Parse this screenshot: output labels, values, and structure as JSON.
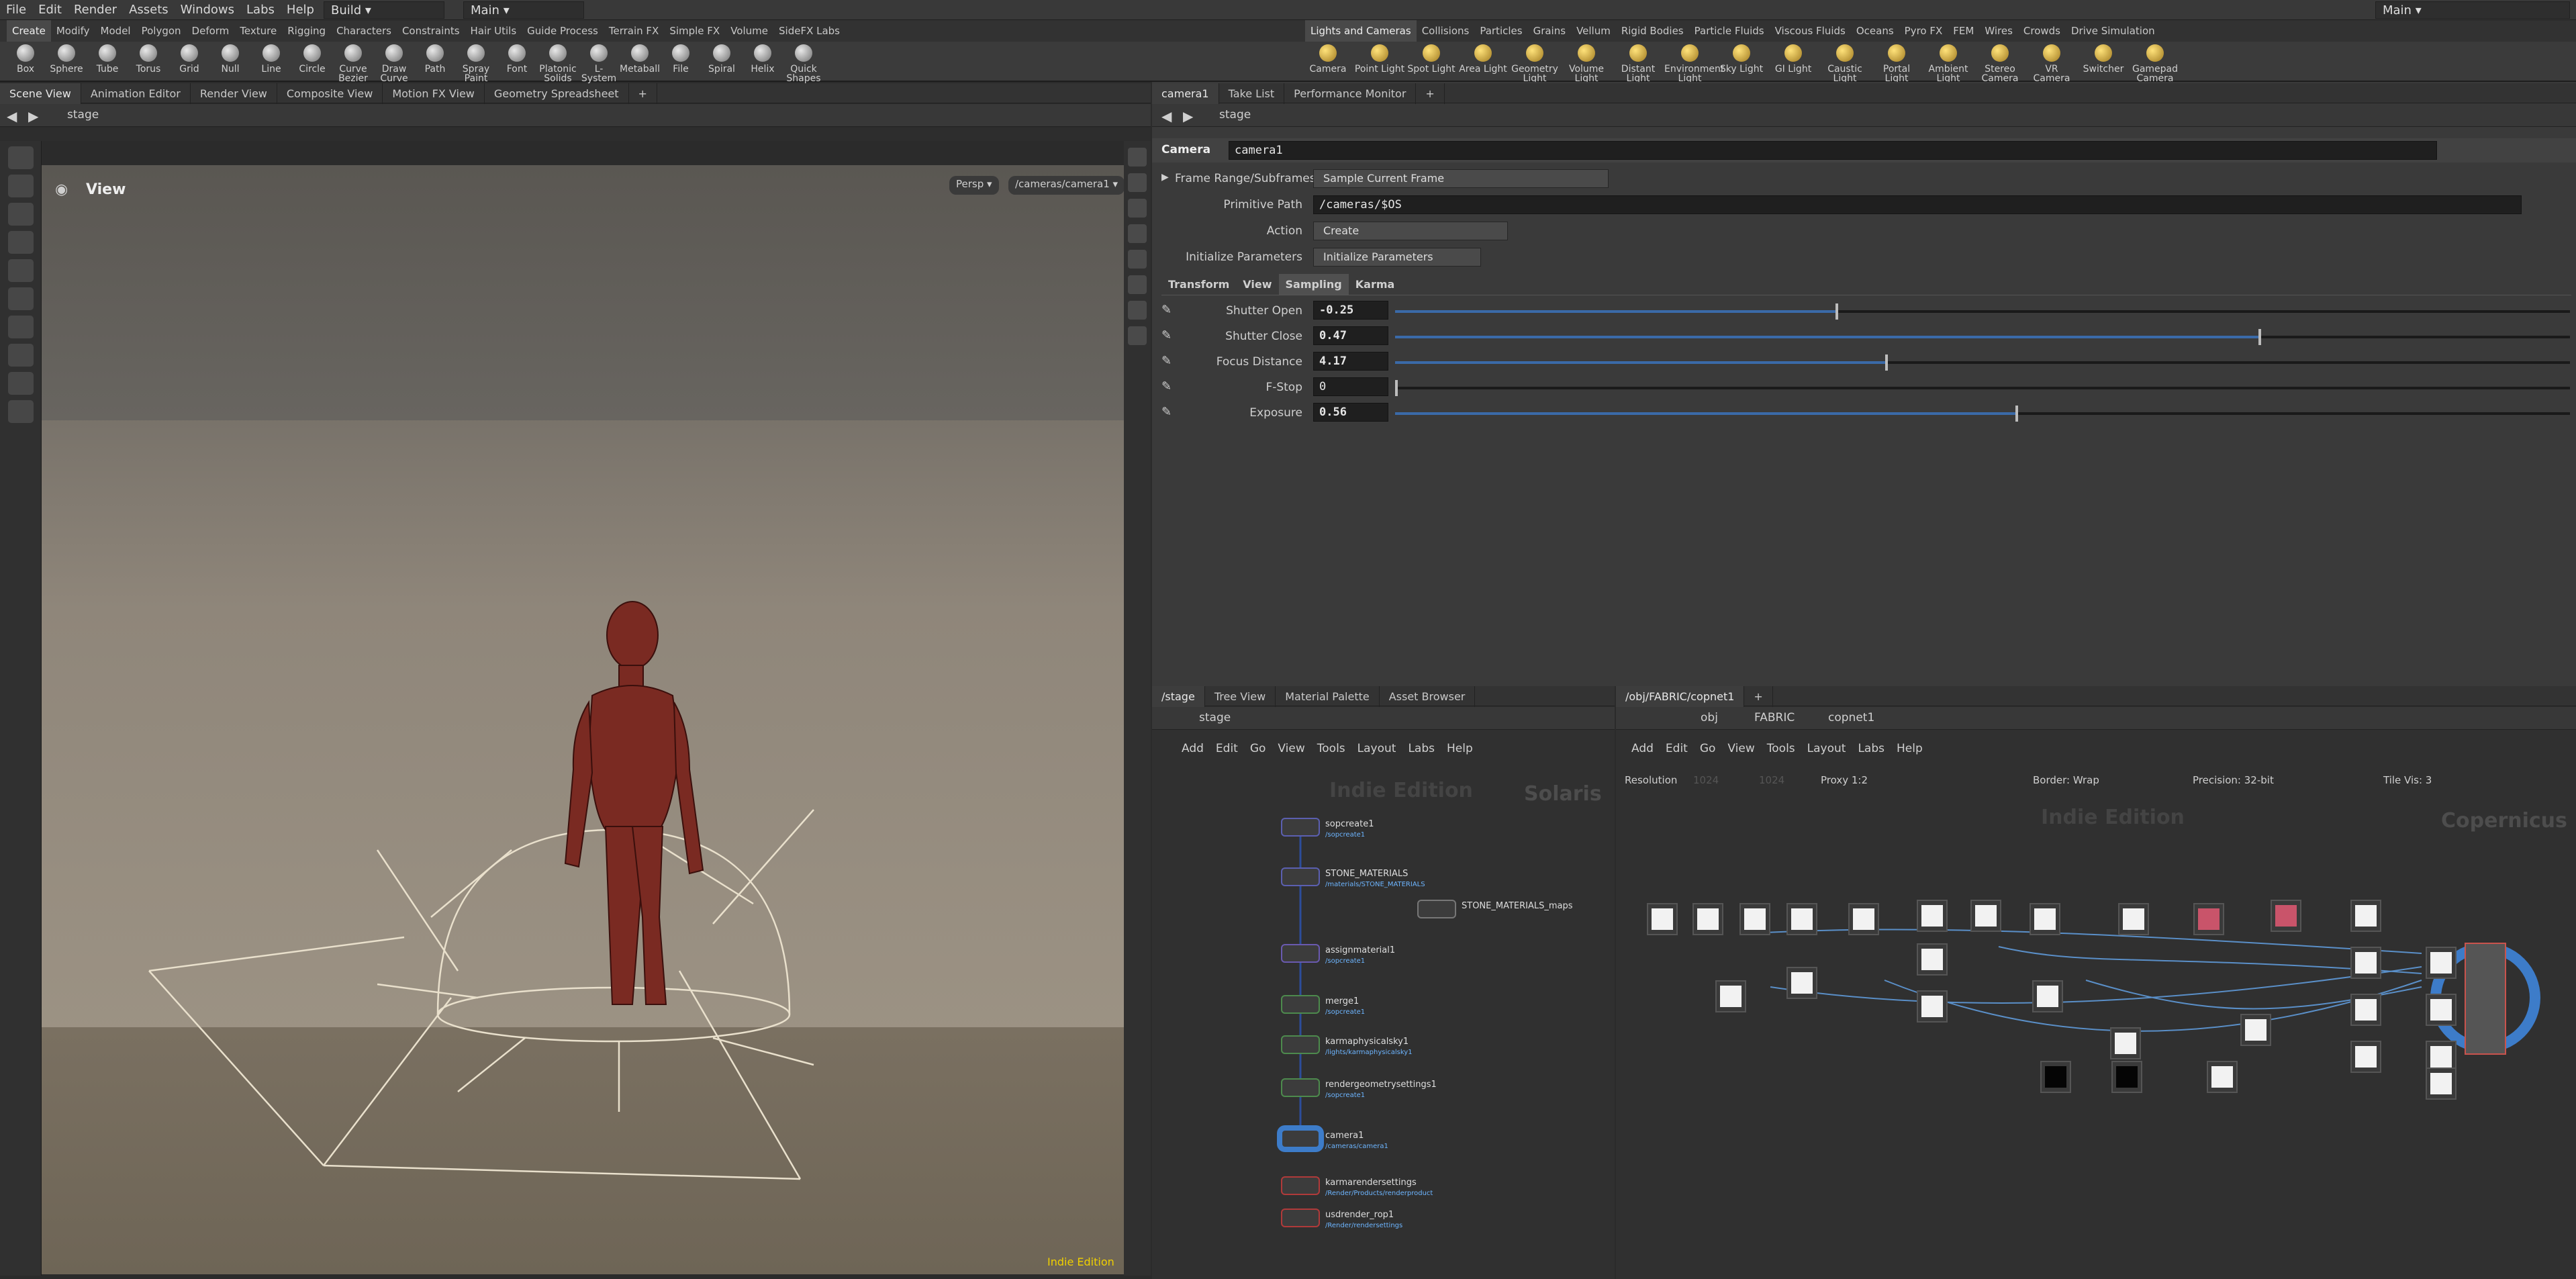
{
  "menubar": {
    "items": [
      "File",
      "Edit",
      "Render",
      "Assets",
      "Windows",
      "Labs",
      "Help"
    ],
    "desktop": "Build",
    "context": "Main",
    "right_context": "Main"
  },
  "shelf_left": {
    "tabs": [
      "Create",
      "Modify",
      "Model",
      "Polygon",
      "Deform",
      "Texture",
      "Rigging",
      "Characters",
      "Constraints",
      "Hair Utils",
      "Guide Process",
      "Terrain FX",
      "Simple FX",
      "Volume",
      "SideFX Labs"
    ],
    "tools": [
      "Box",
      "Sphere",
      "Tube",
      "Torus",
      "Grid",
      "Null",
      "Line",
      "Circle",
      "Curve Bezier",
      "Draw Curve",
      "Path",
      "Spray Paint",
      "Font",
      "Platonic Solids",
      "L-System",
      "Metaball",
      "File",
      "Spiral",
      "Helix",
      "Quick Shapes"
    ]
  },
  "shelf_right": {
    "tabs": [
      "Lights and Cameras",
      "Collisions",
      "Particles",
      "Grains",
      "Vellum",
      "Rigid Bodies",
      "Particle Fluids",
      "Viscous Fluids",
      "Oceans",
      "Pyro FX",
      "FEM",
      "Wires",
      "Crowds",
      "Drive Simulation"
    ],
    "tools": [
      "Camera",
      "Point Light",
      "Spot Light",
      "Area Light",
      "Geometry Light",
      "Volume Light",
      "Distant Light",
      "Environment Light",
      "Sky Light",
      "GI Light",
      "Caustic Light",
      "Portal Light",
      "Ambient Light",
      "Stereo Camera",
      "VR Camera",
      "Switcher",
      "Gamepad Camera"
    ]
  },
  "scene_panel": {
    "tabs": [
      "Scene View",
      "Animation Editor",
      "Render View",
      "Composite View",
      "Motion FX View",
      "Geometry Spreadsheet"
    ],
    "path": "stage",
    "view_title": "View",
    "persp": "Persp",
    "camera": "/cameras/camera1",
    "edition": "Indie Edition"
  },
  "param_panel": {
    "tabs": [
      "camera1",
      "Take List",
      "Performance Monitor"
    ],
    "path": "stage",
    "node_type": "Camera",
    "node_name": "camera1",
    "frame_range_label": "Frame Range/Subframes",
    "frame_range_value": "Sample Current Frame",
    "prim_path_label": "Primitive Path",
    "prim_path_value": "/cameras/$OS",
    "action_label": "Action",
    "action_value": "Create",
    "init_label": "Initialize Parameters",
    "init_value": "Initialize Parameters",
    "subtabs": [
      "Transform",
      "View",
      "Sampling",
      "Karma"
    ],
    "params": [
      {
        "label": "Shutter Open",
        "value": "-0.25",
        "level": 0.375
      },
      {
        "label": "Shutter Close",
        "value": "0.47",
        "level": 0.735
      },
      {
        "label": "Focus Distance",
        "value": "4.17",
        "level": 0.417
      },
      {
        "label": "F-Stop",
        "value": "0",
        "level": 0.0
      },
      {
        "label": "Exposure",
        "value": "0.56",
        "level": 0.528
      }
    ]
  },
  "stage_net": {
    "tabs": [
      "/stage",
      "Tree View",
      "Material Palette",
      "Asset Browser"
    ],
    "path": "stage",
    "menu": [
      "Add",
      "Edit",
      "Go",
      "View",
      "Tools",
      "Layout",
      "Labs",
      "Help"
    ],
    "edition": "Indie Edition",
    "context": "Solaris",
    "nodes": [
      {
        "name": "sopcreate1",
        "sub": "/sopcreate1"
      },
      {
        "name": "STONE_MATERIALS",
        "sub": "/materials/STONE_MATERIALS"
      },
      {
        "name": "STONE_MATERIALS_maps",
        "sub": ""
      },
      {
        "name": "assignmaterial1",
        "sub": "/sopcreate1"
      },
      {
        "name": "merge1",
        "sub": "/sopcreate1"
      },
      {
        "name": "karmaphysicalsky1",
        "sub": "/lights/karmaphysicalsky1"
      },
      {
        "name": "rendergeometrysettings1",
        "sub": "/sopcreate1"
      },
      {
        "name": "camera1",
        "sub": "/cameras/camera1"
      },
      {
        "name": "karmarendersettings",
        "sub": "/Render/Products/renderproduct"
      },
      {
        "name": "usdrender_rop1",
        "sub": "/Render/rendersettings"
      }
    ]
  },
  "cop_net": {
    "tab": "/obj/FABRIC/copnet1",
    "path": [
      "obj",
      "FABRIC",
      "copnet1"
    ],
    "menu": [
      "Add",
      "Edit",
      "Go",
      "View",
      "Tools",
      "Layout",
      "Labs",
      "Help"
    ],
    "resolution_label": "Resolution",
    "res_x": "1024",
    "res_y": "1024",
    "proxy": "Proxy 1:2",
    "border": "Border: Wrap",
    "precision": "Precision: 32-bit",
    "tile_vis": "Tile Vis: 3",
    "edition": "Indie Edition",
    "context": "Copernicus"
  }
}
